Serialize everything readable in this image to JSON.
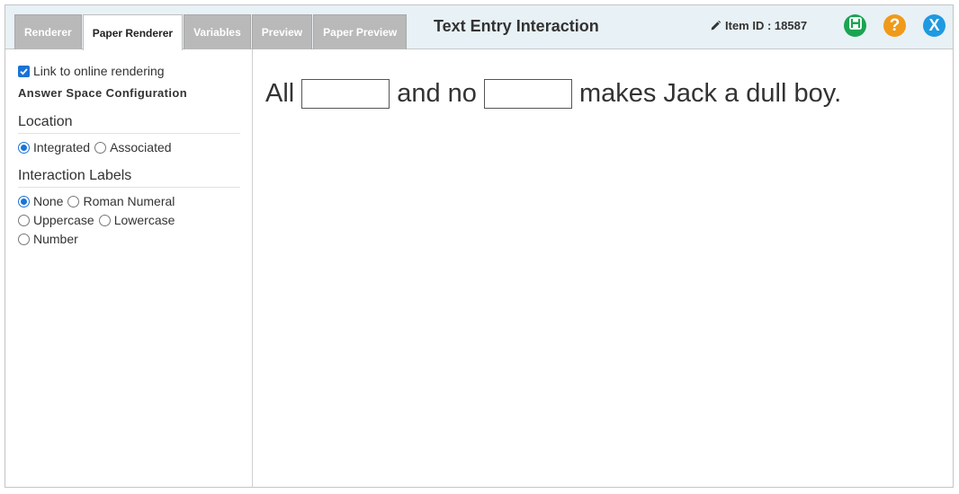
{
  "tabs": [
    {
      "label": "Renderer",
      "active": false
    },
    {
      "label": "Paper Renderer",
      "active": true
    },
    {
      "label": "Variables",
      "active": false
    },
    {
      "label": "Preview",
      "active": false
    },
    {
      "label": "Paper Preview",
      "active": false
    }
  ],
  "header": {
    "title": "Text Entry Interaction",
    "item_id_label": "Item ID : 18587",
    "icons": {
      "edit": "pencil-icon",
      "save": "save-icon",
      "help": "help-icon",
      "close": "close-icon",
      "help_glyph": "?",
      "close_glyph": "X"
    },
    "colors": {
      "save": "#1aa452",
      "help": "#f09a1a",
      "close": "#1f9ae0"
    }
  },
  "sidebar": {
    "link_checkbox": {
      "label": "Link to online rendering",
      "checked": true
    },
    "config_title": "Answer Space Configuration",
    "location": {
      "heading": "Location",
      "options": [
        {
          "label": "Integrated",
          "checked": true
        },
        {
          "label": "Associated",
          "checked": false
        }
      ]
    },
    "interaction_labels": {
      "heading": "Interaction Labels",
      "options": [
        {
          "label": "None",
          "checked": true
        },
        {
          "label": "Roman Numeral",
          "checked": false
        },
        {
          "label": "Uppercase",
          "checked": false
        },
        {
          "label": "Lowercase",
          "checked": false
        },
        {
          "label": "Number",
          "checked": false
        }
      ]
    }
  },
  "preview": {
    "segments": [
      "All",
      "and no",
      "makes Jack a dull boy."
    ]
  },
  "accent_color": "#1a73d6"
}
